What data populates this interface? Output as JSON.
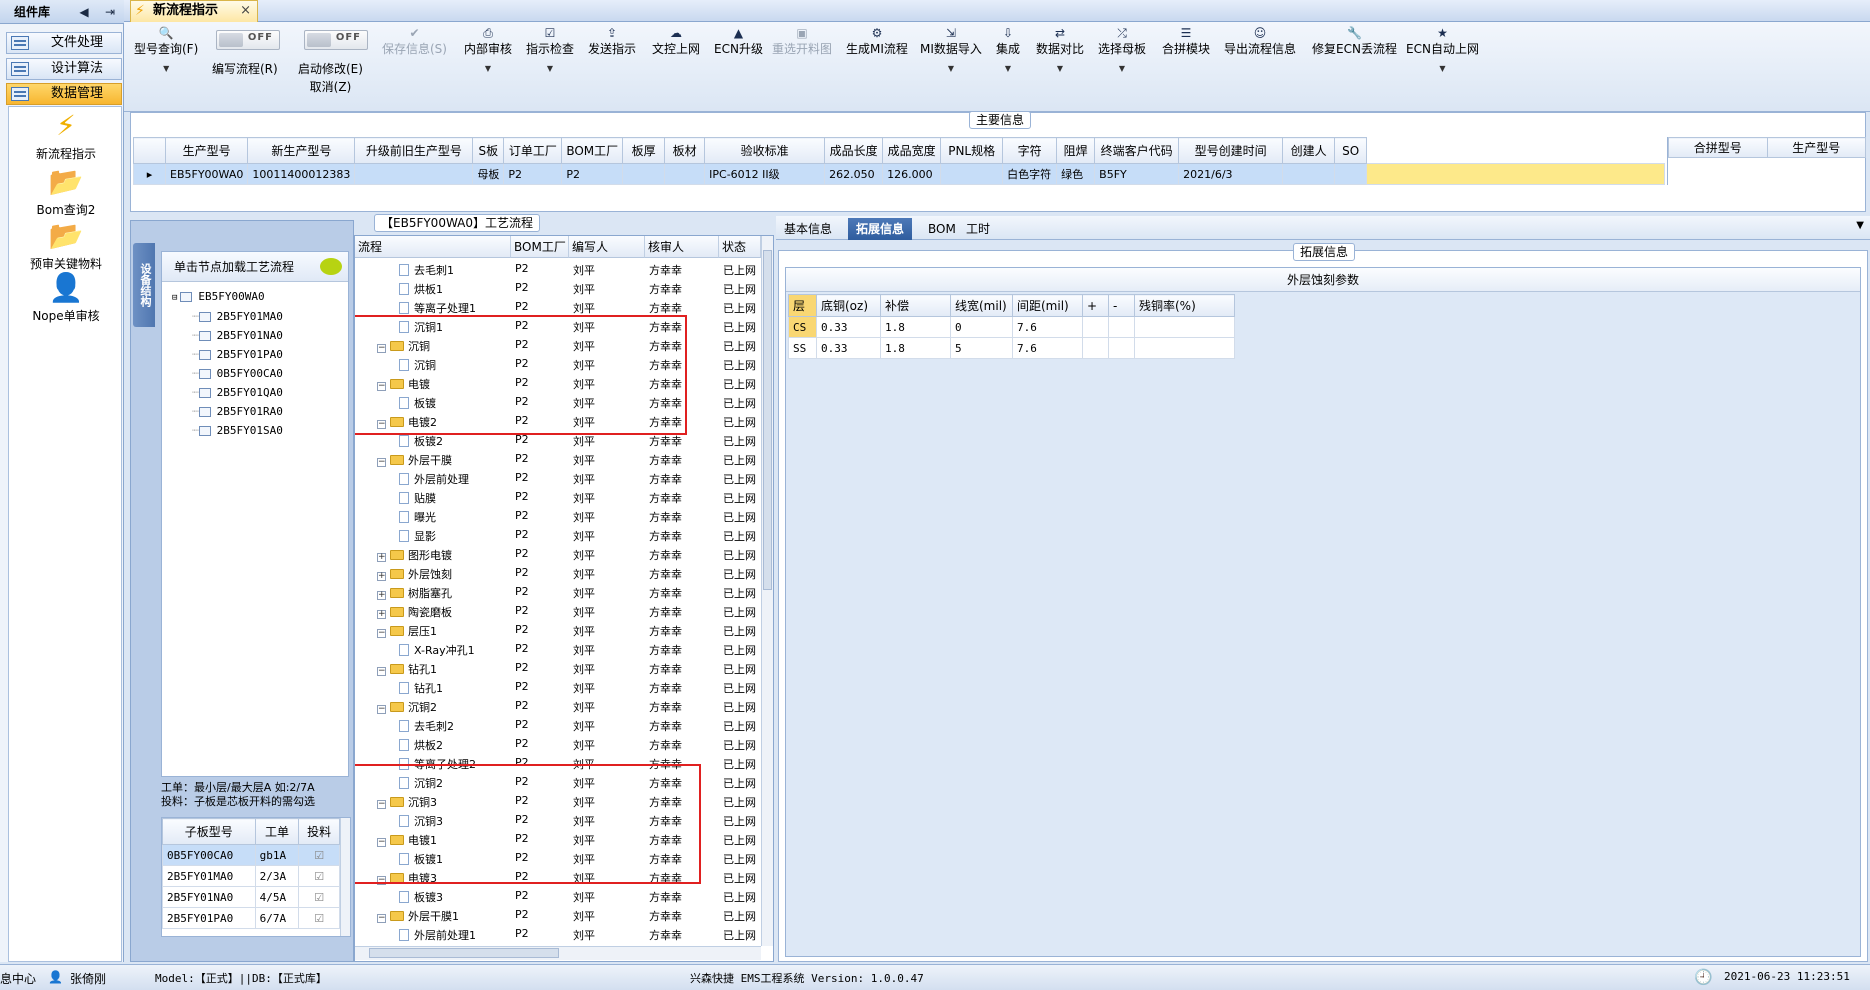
{
  "left_panel": {
    "title": "组件库",
    "menu": [
      {
        "label": "文件处理"
      },
      {
        "label": "设计算法"
      },
      {
        "label": "数据管理"
      }
    ],
    "items": [
      {
        "label": "新流程指示",
        "icon": "lightning-icon"
      },
      {
        "label": "Bom查询2",
        "icon": "folder-icon"
      },
      {
        "label": "预审关键物料",
        "icon": "folder-icon"
      },
      {
        "label": "Nope单审核",
        "icon": "user-icon"
      }
    ]
  },
  "tab": {
    "label": "新流程指示"
  },
  "toolbar": {
    "model_query": "型号查询(F)",
    "edit_flow": "编写流程(R)",
    "start_modify": "启动修改(E)",
    "cancel": "取消(Z)",
    "off_label": "OFF",
    "save_info": "保存信息(S)",
    "internal_review": "内部审核",
    "check_instruction": "指示检查",
    "send_instruction": "发送指示",
    "cam_upload": "文控上网",
    "ecn_upgrade": "ECN升级",
    "reselect_image": "重选开料图",
    "gen_mi": "生成MI流程",
    "mi_import": "MI数据导入",
    "merge": "集成",
    "data_compare": "数据对比",
    "select_master": "选择母板",
    "merge_module": "合拼模块",
    "export_flow": "导出流程信息",
    "repair_ecn": "修复ECN丢流程",
    "ecn_auto": "ECN自动上网"
  },
  "main_info": {
    "title": "主要信息",
    "headers": [
      "生产型号",
      "新生产型号",
      "升级前旧生产型号",
      "S板",
      "订单工厂",
      "BOM工厂",
      "板厚",
      "板材",
      "验收标准",
      "成品长度",
      "成品宽度",
      "PNL规格",
      "字符",
      "阻焊",
      "终端客户代码",
      "型号创建时间",
      "创建人",
      "SO"
    ],
    "row": [
      "EB5FY00WA0",
      "10011400012383",
      "",
      "母板",
      "P2",
      "P2",
      "",
      "",
      "IPC-6012 II级",
      "262.050",
      "126.000",
      "",
      "白色字符",
      "绿色",
      "B5FY",
      "2021/6/3",
      "",
      ""
    ],
    "right_headers": [
      "合拼型号",
      "生产型号"
    ]
  },
  "struct_panel": {
    "vtab": "设备结构",
    "load_hint": "单击节点加载工艺流程",
    "root": "EB5FY00WA0",
    "children": [
      "2B5FY01MA0",
      "2B5FY01NA0",
      "2B5FY01PA0",
      "0B5FY00CA0",
      "2B5FY01QA0",
      "2B5FY01RA0",
      "2B5FY01SA0"
    ],
    "note1": "工单：最小层/最大层A 如:2/7A",
    "note2": "投料：子板是芯板开料的需勾选",
    "child_headers": [
      "子板型号",
      "工单",
      "投料"
    ],
    "child_rows": [
      {
        "model": "0B5FY00CA0",
        "order": "gb1A"
      },
      {
        "model": "2B5FY01MA0",
        "order": "2/3A"
      },
      {
        "model": "2B5FY01NA0",
        "order": "4/5A"
      },
      {
        "model": "2B5FY01PA0",
        "order": "6/7A"
      }
    ]
  },
  "flow_panel": {
    "title": "【EB5FY00WA0】工艺流程",
    "headers": [
      "流程",
      "BOM工厂",
      "编写人",
      "核审人",
      "状态"
    ],
    "rows": [
      {
        "name": "去毛刺1",
        "level": 2,
        "type": "doc"
      },
      {
        "name": "烘板1",
        "level": 2,
        "type": "doc"
      },
      {
        "name": "等离子处理1",
        "level": 2,
        "type": "doc"
      },
      {
        "name": "沉铜1",
        "level": 2,
        "type": "doc"
      },
      {
        "name": "沉铜",
        "level": 1,
        "type": "folder"
      },
      {
        "name": "沉铜",
        "level": 2,
        "type": "doc"
      },
      {
        "name": "电镀",
        "level": 1,
        "type": "folder"
      },
      {
        "name": "板镀",
        "level": 2,
        "type": "doc"
      },
      {
        "name": "电镀2",
        "level": 1,
        "type": "folder"
      },
      {
        "name": "板镀2",
        "level": 2,
        "type": "doc"
      },
      {
        "name": "外层干膜",
        "level": 1,
        "type": "folder"
      },
      {
        "name": "外层前处理",
        "level": 2,
        "type": "doc"
      },
      {
        "name": "贴膜",
        "level": 2,
        "type": "doc"
      },
      {
        "name": "曝光",
        "level": 2,
        "type": "doc"
      },
      {
        "name": "显影",
        "level": 2,
        "type": "doc"
      },
      {
        "name": "图形电镀",
        "level": 1,
        "type": "folder-collapsed"
      },
      {
        "name": "外层蚀刻",
        "level": 1,
        "type": "folder-collapsed"
      },
      {
        "name": "树脂塞孔",
        "level": 1,
        "type": "folder-collapsed"
      },
      {
        "name": "陶瓷磨板",
        "level": 1,
        "type": "folder-collapsed"
      },
      {
        "name": "层压1",
        "level": 1,
        "type": "folder"
      },
      {
        "name": "X-Ray冲孔1",
        "level": 2,
        "type": "doc"
      },
      {
        "name": "钻孔1",
        "level": 1,
        "type": "folder"
      },
      {
        "name": "钻孔1",
        "level": 2,
        "type": "doc"
      },
      {
        "name": "沉铜2",
        "level": 1,
        "type": "folder"
      },
      {
        "name": "去毛刺2",
        "level": 2,
        "type": "doc"
      },
      {
        "name": "烘板2",
        "level": 2,
        "type": "doc"
      },
      {
        "name": "等离子处理2",
        "level": 2,
        "type": "doc"
      },
      {
        "name": "沉铜2",
        "level": 2,
        "type": "doc"
      },
      {
        "name": "沉铜3",
        "level": 1,
        "type": "folder"
      },
      {
        "name": "沉铜3",
        "level": 2,
        "type": "doc"
      },
      {
        "name": "电镀1",
        "level": 1,
        "type": "folder"
      },
      {
        "name": "板镀1",
        "level": 2,
        "type": "doc"
      },
      {
        "name": "电镀3",
        "level": 1,
        "type": "folder"
      },
      {
        "name": "板镀3",
        "level": 2,
        "type": "doc"
      },
      {
        "name": "外层干膜1",
        "level": 1,
        "type": "folder"
      },
      {
        "name": "外层前处理1",
        "level": 2,
        "type": "doc"
      }
    ],
    "factory": "P2",
    "writer": "刘平",
    "reviewer": "方幸幸",
    "status": "已上网"
  },
  "right_panel": {
    "tabs": [
      "基本信息",
      "拓展信息",
      "BOM",
      "工时"
    ],
    "ext_title": "拓展信息",
    "etch_title": "外层蚀刻参数",
    "etch_headers": [
      "层",
      "底铜(oz)",
      "补偿",
      "线宽(mil)",
      "间距(mil)",
      "+",
      "-",
      "残铜率(%)"
    ],
    "etch_rows": [
      [
        "CS",
        "0.33",
        "1.8",
        "0",
        "7.6",
        "",
        "",
        ""
      ],
      [
        "SS",
        "0.33",
        "1.8",
        "5",
        "7.6",
        "",
        "",
        ""
      ]
    ]
  },
  "status_bar": {
    "msg_center": "息中心",
    "user": "张倚刚",
    "model": "Model:【正式】||DB:【正式库】",
    "system": "兴森快捷 EMS工程系统 Version: 1.0.0.47",
    "datetime": "2021-06-23 11:23:51"
  },
  "colors": {
    "accent": "#2f5d9e",
    "highlight_row": "#c6ddf8",
    "selected_yellow": "#fde98a",
    "red_box": "#e02020"
  }
}
